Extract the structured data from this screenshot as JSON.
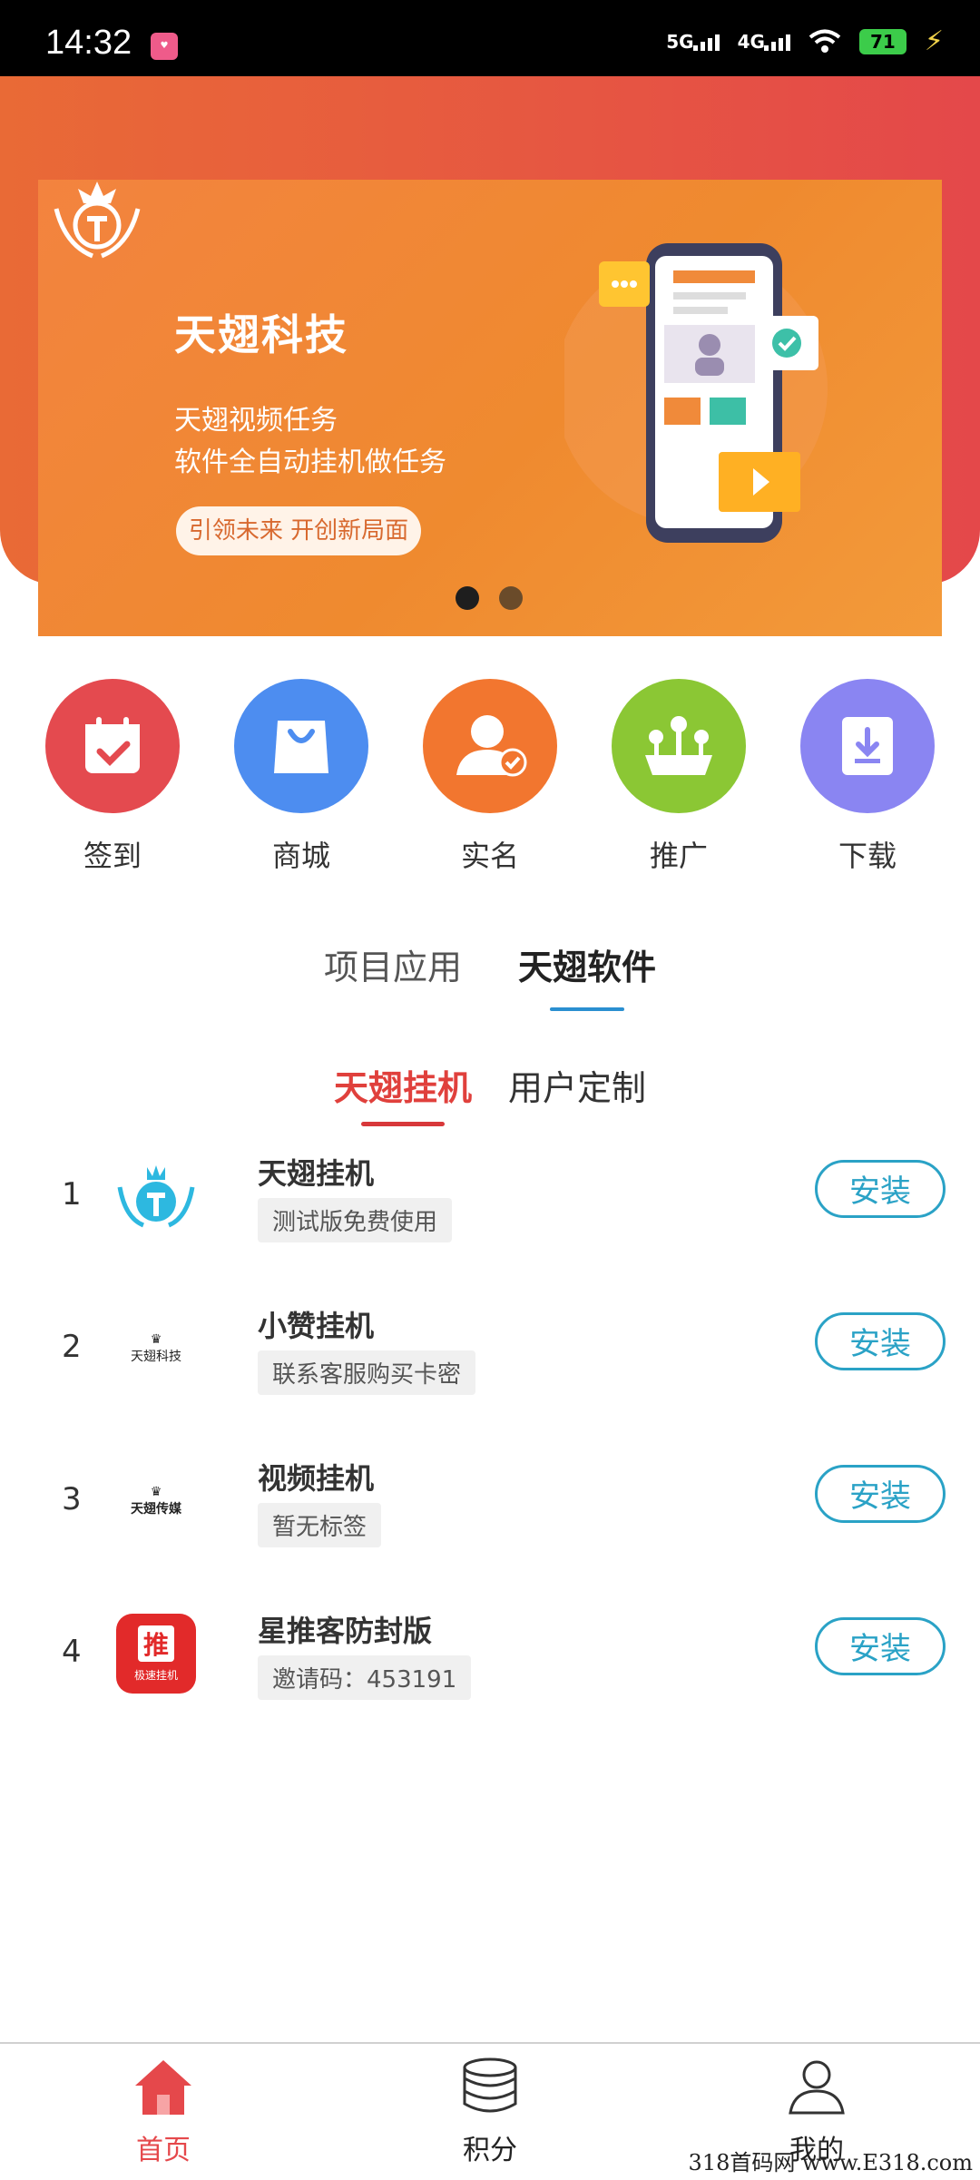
{
  "status_bar": {
    "time": "14:32",
    "network1": "5G",
    "network2": "4G",
    "battery": "71"
  },
  "banner": {
    "brand": "天翅科技",
    "line1": "天翅视频任务",
    "line2": "软件全自动挂机做任务",
    "pill": "引领未来  开创新局面"
  },
  "shortcuts": [
    {
      "label": "签到",
      "icon": "calendar-check-icon",
      "color": "#e44a4f"
    },
    {
      "label": "商城",
      "icon": "shopping-bag-icon",
      "color": "#4d8df0"
    },
    {
      "label": "实名",
      "icon": "user-verified-icon",
      "color": "#f2762f"
    },
    {
      "label": "推广",
      "icon": "share-icon",
      "color": "#8bc734"
    },
    {
      "label": "下载",
      "icon": "download-icon",
      "color": "#8a85f2"
    }
  ],
  "tabs_primary": [
    {
      "label": "项目应用"
    },
    {
      "label": "天翅软件"
    }
  ],
  "tabs_secondary": [
    {
      "label": "天翅挂机"
    },
    {
      "label": "用户定制"
    }
  ],
  "apps": [
    {
      "rank": "1",
      "name": "天翅挂机",
      "tag": "测试版免费使用",
      "action": "安装"
    },
    {
      "rank": "2",
      "name": "小赞挂机",
      "tag": "联系客服购买卡密",
      "action": "安装",
      "logo_text": "天翅科技"
    },
    {
      "rank": "3",
      "name": "视频挂机",
      "tag": "暂无标签",
      "action": "安装",
      "logo_text": "天翅传媒"
    },
    {
      "rank": "4",
      "name": "星推客防封版",
      "tag": "邀请码：453191",
      "action": "安装",
      "logo_text1": "推",
      "logo_text2": "极速挂机"
    }
  ],
  "bottom_nav": [
    {
      "label": "首页"
    },
    {
      "label": "积分"
    },
    {
      "label": "我的"
    }
  ],
  "watermark": "318首码网 www.E318.com"
}
